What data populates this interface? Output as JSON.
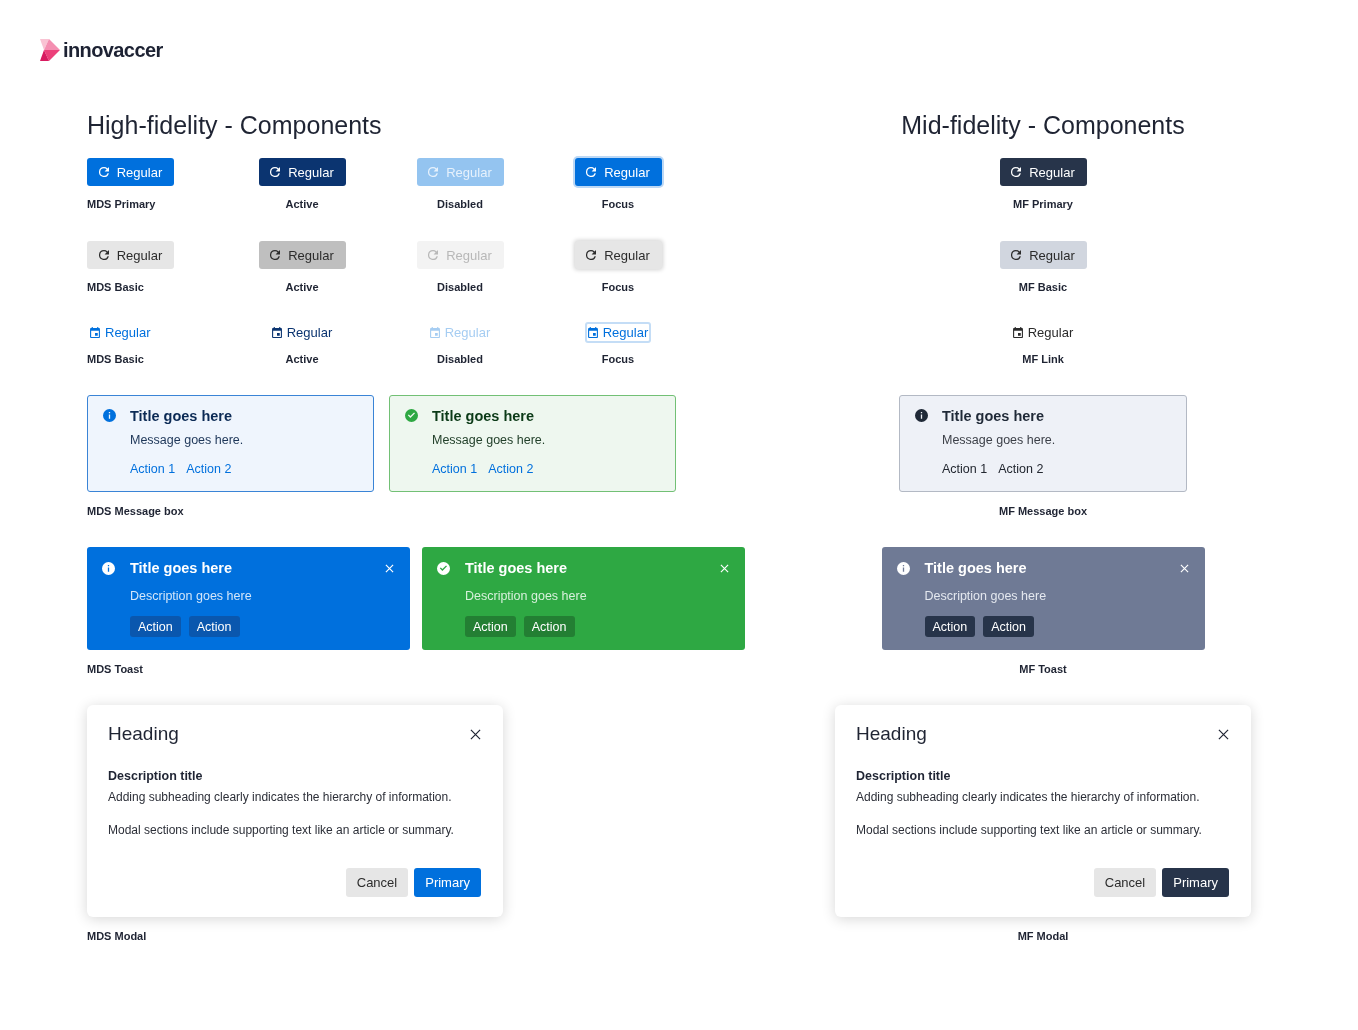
{
  "logo": {
    "text": "innovaccer"
  },
  "sections": [
    {
      "kind": "mds",
      "title": "High-fidelity - Components",
      "button_rows": [
        {
          "kind": "primary",
          "items": [
            {
              "label": "Regular",
              "caption": "MDS Primary",
              "active": false,
              "disabled": false,
              "focused": false
            },
            {
              "label": "Regular",
              "caption": "Active",
              "active": true,
              "disabled": false,
              "focused": false
            },
            {
              "label": "Regular",
              "caption": "Disabled",
              "active": false,
              "disabled": true,
              "focused": false
            },
            {
              "label": "Regular",
              "caption": "Focus",
              "active": false,
              "disabled": false,
              "focused": true
            }
          ]
        },
        {
          "kind": "basic",
          "items": [
            {
              "label": "Regular",
              "caption": "MDS Basic",
              "active": false,
              "disabled": false,
              "focused": false
            },
            {
              "label": "Regular",
              "caption": "Active",
              "active": true,
              "disabled": false,
              "focused": false
            },
            {
              "label": "Regular",
              "caption": "Disabled",
              "active": false,
              "disabled": true,
              "focused": false
            },
            {
              "label": "Regular",
              "caption": "Focus",
              "active": false,
              "disabled": false,
              "focused": true
            }
          ]
        },
        {
          "kind": "link",
          "items": [
            {
              "label": "Regular",
              "caption": "MDS Basic",
              "active": false,
              "disabled": false,
              "focused": false
            },
            {
              "label": "Regular",
              "caption": "Active",
              "active": true,
              "disabled": false,
              "focused": false
            },
            {
              "label": "Regular",
              "caption": "Disabled",
              "active": false,
              "disabled": true,
              "focused": false
            },
            {
              "label": "Regular",
              "caption": "Focus",
              "active": false,
              "disabled": false,
              "focused": true
            }
          ]
        }
      ],
      "message_boxes": {
        "caption": "MDS Message box",
        "items": [
          {
            "kind": "info",
            "title": "Title goes here",
            "message": "Message goes here.",
            "actions": [
              "Action 1",
              "Action 2"
            ]
          },
          {
            "kind": "success",
            "title": "Title goes here",
            "message": "Message goes here.",
            "actions": [
              "Action 1",
              "Action 2"
            ]
          }
        ]
      },
      "toasts": {
        "caption": "MDS Toast",
        "items": [
          {
            "kind": "info",
            "title": "Title goes here",
            "description": "Description goes here",
            "actions": [
              "Action",
              "Action"
            ]
          },
          {
            "kind": "success",
            "title": "Title goes here",
            "description": "Description goes here",
            "actions": [
              "Action",
              "Action"
            ]
          }
        ]
      },
      "modal": {
        "heading": "Heading",
        "description_title": "Description title",
        "description": "Adding subheading clearly indicates the hierarchy of information.",
        "body": "Modal sections include supporting text like an article or summary.",
        "buttons": [
          {
            "label": "Cancel",
            "kind": "basic"
          },
          {
            "label": "Primary",
            "kind": "primary"
          }
        ],
        "caption": "MDS Modal"
      }
    },
    {
      "kind": "mf",
      "title": "Mid-fidelity - Components",
      "button_rows": [
        {
          "kind": "primary",
          "items": [
            {
              "label": "Regular",
              "caption": "MF Primary",
              "active": false,
              "disabled": false,
              "focused": false
            }
          ]
        },
        {
          "kind": "basic",
          "items": [
            {
              "label": "Regular",
              "caption": "MF Basic",
              "active": false,
              "disabled": false,
              "focused": false
            }
          ]
        },
        {
          "kind": "link",
          "items": [
            {
              "label": "Regular",
              "caption": "MF Link",
              "active": false,
              "disabled": false,
              "focused": false
            }
          ]
        }
      ],
      "message_boxes": {
        "caption": "MF Message box",
        "items": [
          {
            "kind": "info",
            "title": "Title goes here",
            "message": "Message goes here.",
            "actions": [
              "Action 1",
              "Action 2"
            ]
          }
        ]
      },
      "toasts": {
        "caption": "MF Toast",
        "items": [
          {
            "kind": "info",
            "title": "Title goes here",
            "description": "Description goes here",
            "actions": [
              "Action",
              "Action"
            ]
          }
        ]
      },
      "modal": {
        "heading": "Heading",
        "description_title": "Description title",
        "description": "Adding subheading clearly indicates the hierarchy of information.",
        "body": "Modal sections include supporting text like an article or summary.",
        "buttons": [
          {
            "label": "Cancel",
            "kind": "basic"
          },
          {
            "label": "Primary",
            "kind": "primary"
          }
        ],
        "caption": "MF Modal"
      }
    }
  ]
}
